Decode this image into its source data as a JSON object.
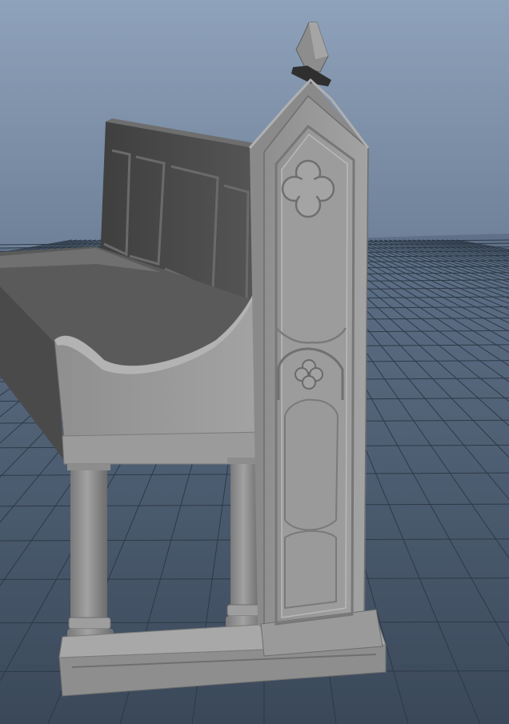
{
  "viewport": {
    "background_top": "#8fa3bd",
    "background_bottom": "#3f4f62",
    "grid_color": "#2a3644",
    "grid_major_color": "#1c2530"
  },
  "model": {
    "name": "gothic-church-pew",
    "material_light": "#9a9a9a",
    "material_mid": "#7d7d7d",
    "material_dark": "#4b4b4b",
    "material_shadow": "#3a3a3a"
  }
}
